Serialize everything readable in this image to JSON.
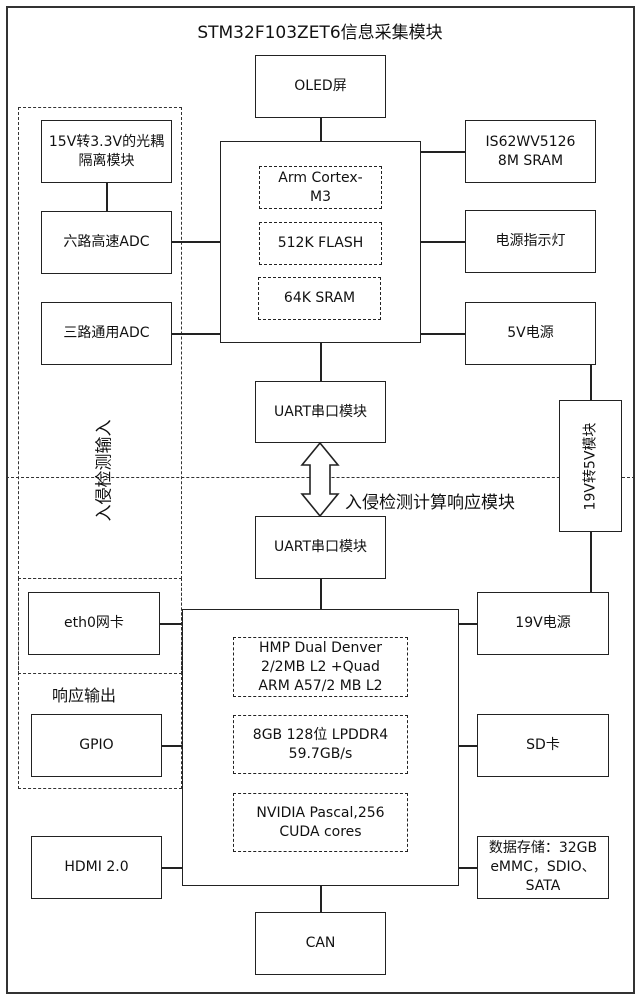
{
  "title": "STM32F103ZET6信息采集模块",
  "labels": {
    "input_region": "入侵检测输入",
    "output_region": "响应输出",
    "compute_module": "入侵检测计算响应模块"
  },
  "stm32": {
    "oled": "OLED屏",
    "optocoupler": "15V转3.3V的光耦隔离模块",
    "adc6": "六路高速ADC",
    "adc3": "三路通用ADC",
    "sram_ext": "IS62WV5126 8M SRAM",
    "power_led": "电源指示灯",
    "power_5v": "5V电源",
    "mcu_core": "Arm Cortex-M3",
    "mcu_flash": "512K FLASH",
    "mcu_sram": "64K SRAM",
    "uart": "UART串口模块"
  },
  "converter": "19V转5V模块",
  "jetson": {
    "uart": "UART串口模块",
    "cpu": "HMP Dual Denver 2/2MB L2 +Quad ARM A57/2 MB L2",
    "memory": "8GB 128位 LPDDR4 59.7GB/s",
    "gpu": "NVIDIA Pascal,256 CUDA cores",
    "eth": "eth0网卡",
    "gpio": "GPIO",
    "hdmi": "HDMI 2.0",
    "power_19v": "19V电源",
    "sd": "SD卡",
    "storage": "数据存储：32GB eMMC，SDIO、SATA",
    "can": "CAN"
  }
}
